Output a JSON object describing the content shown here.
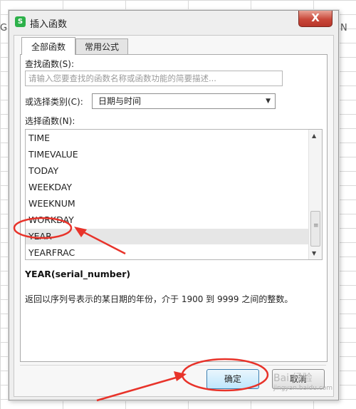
{
  "dialog": {
    "app_icon_letter": "S",
    "title": "插入函数",
    "close_label": "X"
  },
  "background": {
    "col_g": "G",
    "col_n": "N"
  },
  "tabs": [
    {
      "label": "全部函数",
      "active": true
    },
    {
      "label": "常用公式",
      "active": false
    }
  ],
  "search": {
    "label": "查找函数(S):",
    "placeholder": "请输入您要查找的函数名称或函数功能的简要描述..."
  },
  "category": {
    "label": "或选择类别(C):",
    "value": "日期与时间"
  },
  "functions": {
    "label": "选择函数(N):",
    "items": [
      "TIME",
      "TIMEVALUE",
      "TODAY",
      "WEEKDAY",
      "WEEKNUM",
      "WORKDAY",
      "YEAR",
      "YEARFRAC"
    ],
    "selected": "YEAR"
  },
  "detail": {
    "signature": "YEAR(serial_number)",
    "description": "返回以序列号表示的某日期的年份，介于 1900 到 9999 之间的整数。"
  },
  "buttons": {
    "ok": "确定",
    "cancel": "取消"
  },
  "watermark": {
    "text": "Bai 经验",
    "sub": "jingyan.baidu.com"
  },
  "colors": {
    "annotation": "#e8332a",
    "close_button": "#c9483a",
    "app_icon": "#2db14a"
  }
}
